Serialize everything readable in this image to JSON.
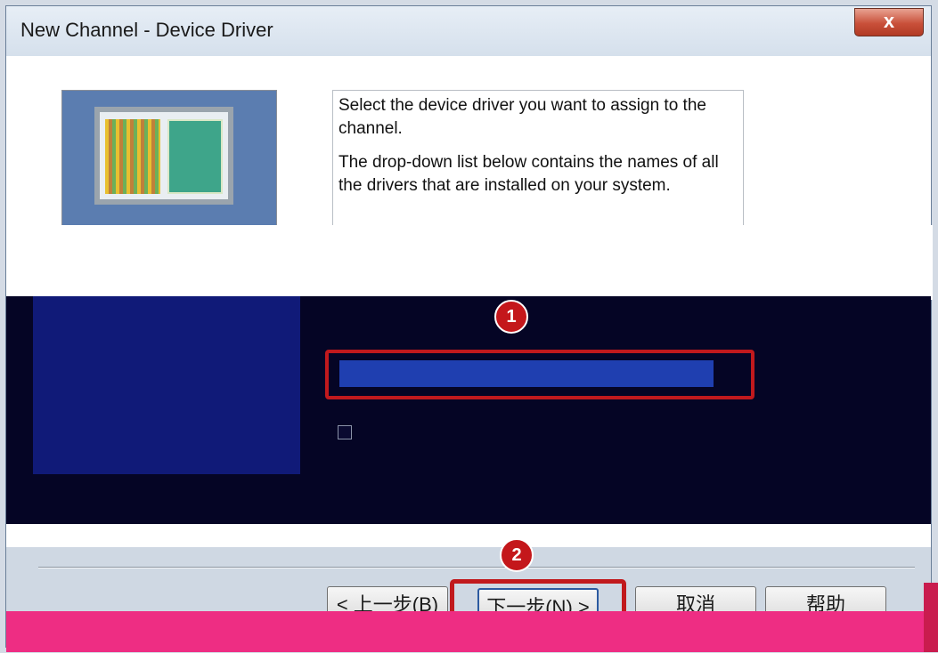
{
  "window": {
    "title": "New Channel - Device Driver",
    "close_label": "x"
  },
  "info": {
    "paragraph1": "Select the device driver you want to assign to the channel.",
    "paragraph2": "The drop-down list below contains the names of all the drivers that are installed on your system."
  },
  "markers": {
    "m1": "1",
    "m2": "2"
  },
  "buttons": {
    "back": "< 上一步(B)",
    "next": "下一步(N) >",
    "cancel": "取消",
    "help": "帮助"
  },
  "colors": {
    "annotation_red": "#c1191d",
    "title_bar": "#d5e0ec",
    "overlay_dark": "#050525",
    "overlay_pink": "#ee2d83"
  },
  "icons": [
    "close-icon",
    "computer-illustration"
  ]
}
